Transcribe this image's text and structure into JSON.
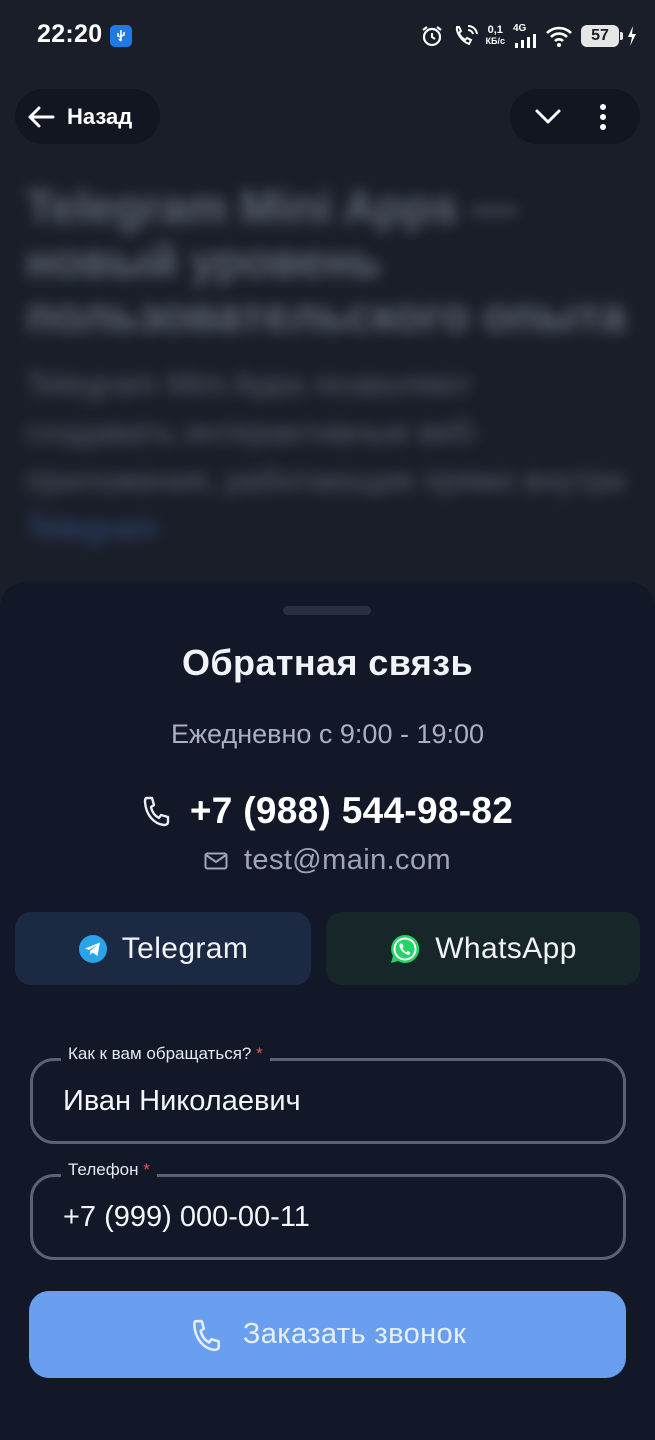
{
  "status_bar": {
    "time": "22:20",
    "net_speed_value": "0,1",
    "net_speed_unit": "КБ/с",
    "network_type": "4G",
    "battery": "57"
  },
  "nav": {
    "back_label": "Назад"
  },
  "article": {
    "title": "Telegram Mini Apps — новый уровень пользовательского опыта",
    "text": "Telegram Mini Apps позволяют создавать интерактивные веб-приложения, работающие прямо внутри",
    "link": "Telegram"
  },
  "sheet": {
    "title": "Обратная связь",
    "hours": "Ежедневно с 9:00 - 19:00",
    "phone": "+7 (988) 544-98-82",
    "email": "test@main.com",
    "messengers": [
      {
        "label": "Telegram",
        "icon": "telegram-icon",
        "color": "#2AA3E8"
      },
      {
        "label": "WhatsApp",
        "icon": "whatsapp-icon",
        "color": "#25D366"
      }
    ],
    "form": {
      "name_label": "Как к вам обращаться?",
      "name_value": "Иван Николаевич",
      "phone_label": "Телефон",
      "phone_value": "+7 (999) 000-00-11",
      "required_mark": "*"
    },
    "call_button_label": "Заказать звонок"
  },
  "colors": {
    "background": "#1a1e28",
    "sheet": "#131829",
    "accent_button": "#6a9ff0",
    "required": "#e25858"
  }
}
